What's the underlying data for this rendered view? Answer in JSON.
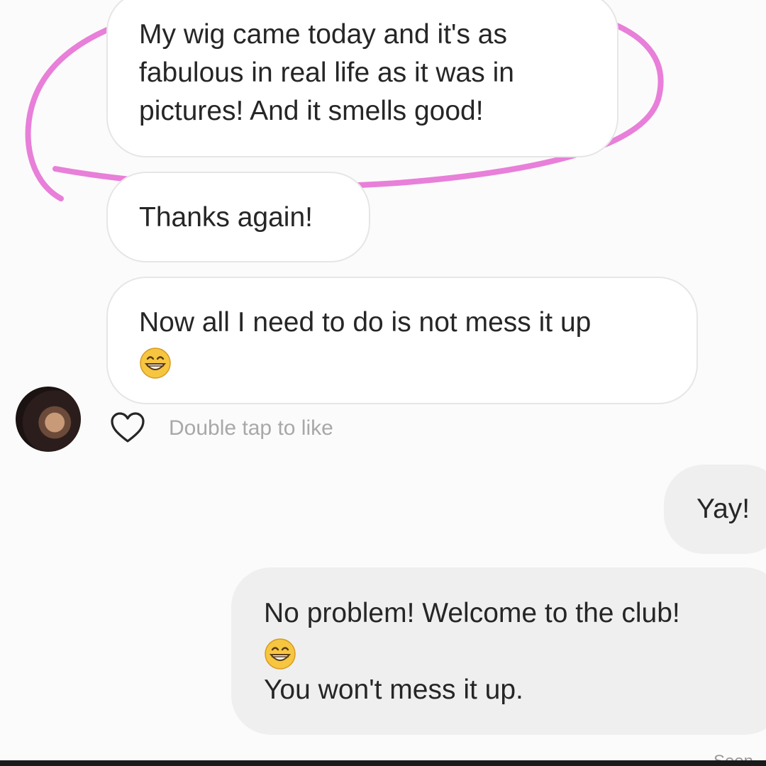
{
  "thread": {
    "messages": [
      {
        "sender": "them",
        "lines": [
          "My wig came today and it's as",
          "fabulous in real life as it was in",
          "pictures! And it smells good!"
        ]
      },
      {
        "sender": "them",
        "lines": [
          "Thanks again!"
        ]
      },
      {
        "sender": "them",
        "lines": [
          "Now all I need to do is not mess it up"
        ],
        "emoji": "grinning-face-icon"
      },
      {
        "sender": "me",
        "lines": [
          "Yay!"
        ]
      },
      {
        "sender": "me",
        "lines": [
          "No problem! Welcome to the club!"
        ],
        "emoji": "grinning-face-icon",
        "lines_after": [
          "You won't mess it up."
        ]
      }
    ],
    "like_hint": "Double tap to like",
    "seen_label": "Seen"
  },
  "icons": {
    "like": "heart-outline-icon",
    "emoji": "grinning-smiling-eyes-icon"
  },
  "colors": {
    "annotation": "#e87fd9",
    "incoming_bubble": "#ffffff",
    "outgoing_bubble": "#efefef",
    "hint_text": "#a8a8a8"
  }
}
